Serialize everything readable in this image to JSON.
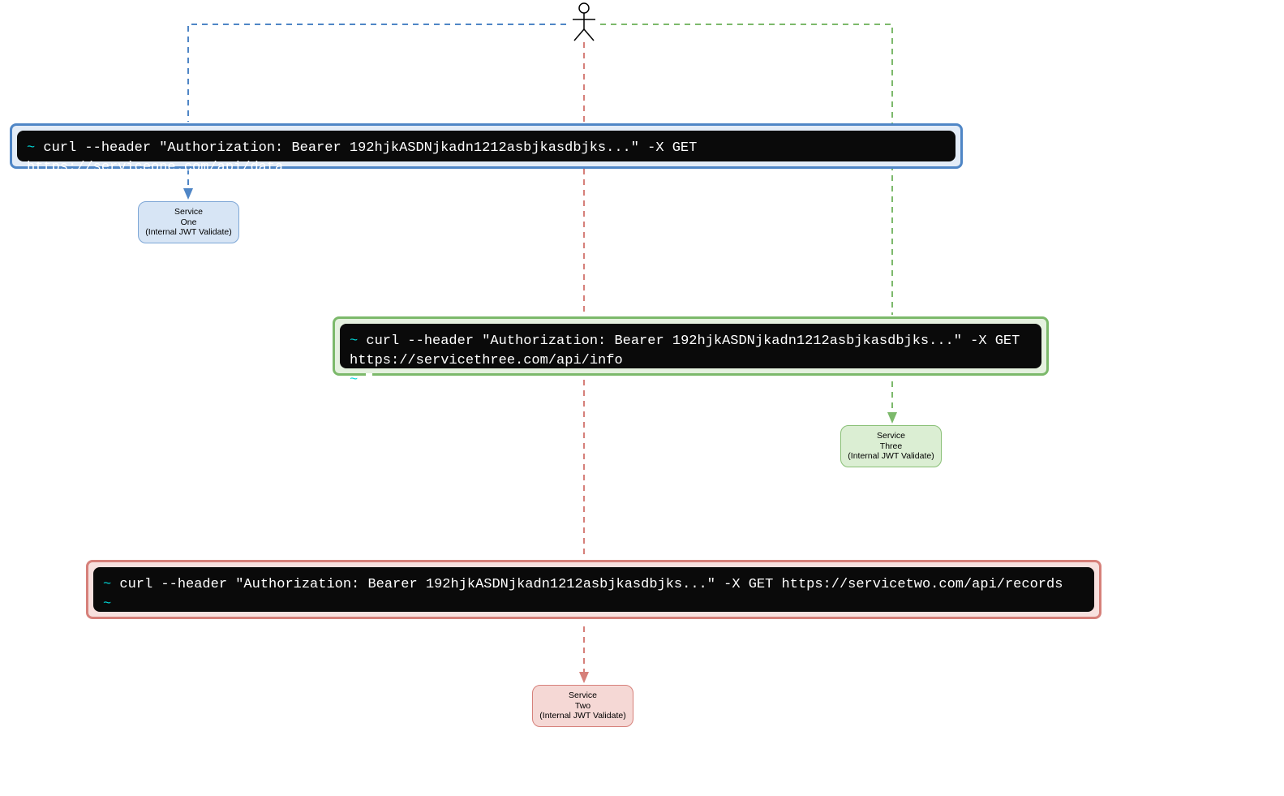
{
  "actor": {
    "label": "user"
  },
  "terminals": {
    "one": {
      "prompt": "~",
      "cmd": "curl --header \"Authorization: Bearer 192hjkASDNjkadn1212asbjkasdbjks...\" -X GET https://serviceone.com/api/data"
    },
    "three": {
      "prompt1": "~",
      "cmd": "curl --header \"Authorization: Bearer 192hjkASDNjkadn1212asbjkasdbjks...\" -X GET https://servicethree.com/api/info",
      "prompt2": "~"
    },
    "two": {
      "prompt1": "~",
      "cmd": "curl --header \"Authorization: Bearer 192hjkASDNjkadn1212asbjkasdbjks...\" -X GET https://servicetwo.com/api/records",
      "prompt2": "~"
    }
  },
  "services": {
    "one": {
      "line1": "Service",
      "line2": "One",
      "line3": "(Internal JWT Validate)"
    },
    "three": {
      "line1": "Service",
      "line2": "Three",
      "line3": "(Internal JWT Validate)"
    },
    "two": {
      "line1": "Service",
      "line2": "Two",
      "line3": "(Internal JWT Validate)"
    }
  },
  "colors": {
    "blue": "#4f86c6",
    "green": "#7cb96b",
    "red": "#d6807a"
  }
}
